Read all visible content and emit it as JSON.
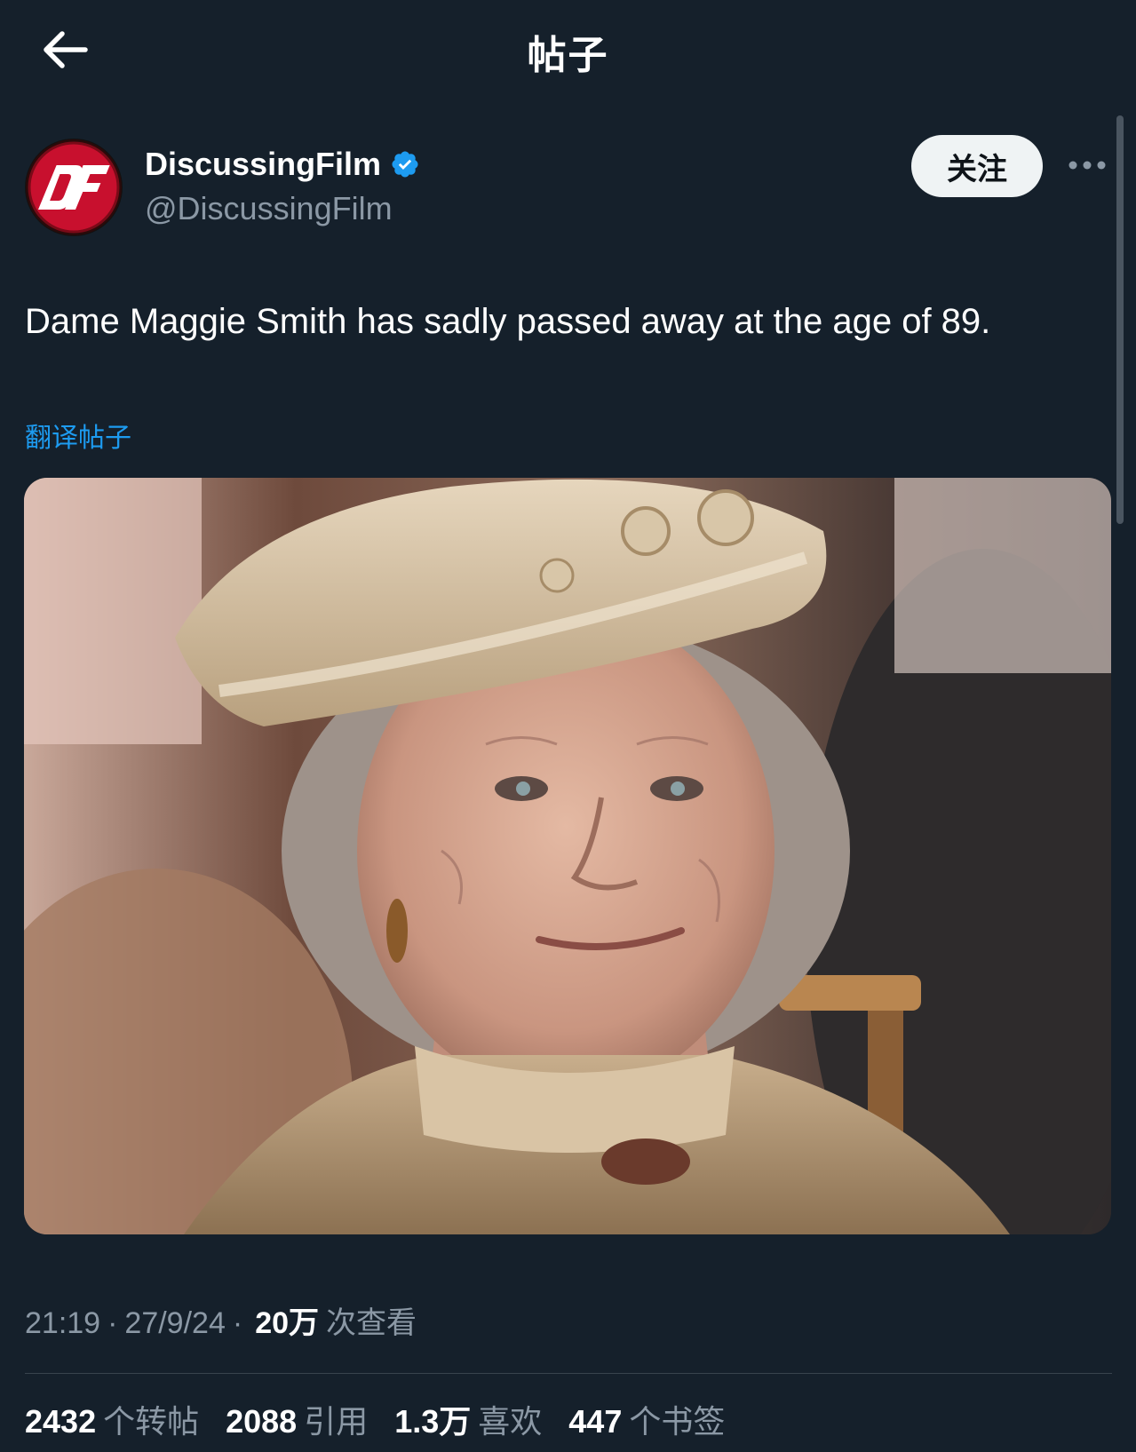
{
  "header": {
    "title": "帖子",
    "back_icon": "arrow-left-icon"
  },
  "author": {
    "display_name": "DiscussingFilm",
    "handle": "@DiscussingFilm",
    "avatar_text": "DF",
    "verified": true,
    "verified_color": "#1d9bf0",
    "brand_color": "#c8102e"
  },
  "actions": {
    "follow_label": "关注",
    "more_icon": "more-horizontal-icon"
  },
  "post": {
    "text": "Dame Maggie Smith has sadly passed away at the age of 89.",
    "translate_label": "翻译帖子",
    "media_alt": "photo-of-woman-in-lace-hat"
  },
  "meta": {
    "time": "21:19",
    "date": "27/9/24",
    "views_count": "20万",
    "views_label": "次查看",
    "separator": "·"
  },
  "stats": [
    {
      "count": "2432",
      "label": "个转帖"
    },
    {
      "count": "2088",
      "label": "引用"
    },
    {
      "count": "1.3万",
      "label": "喜欢"
    },
    {
      "count": "447",
      "label": "个书签"
    }
  ],
  "colors": {
    "background": "#15202b",
    "accent": "#1d9bf0",
    "secondary_text": "#8b98a5"
  }
}
